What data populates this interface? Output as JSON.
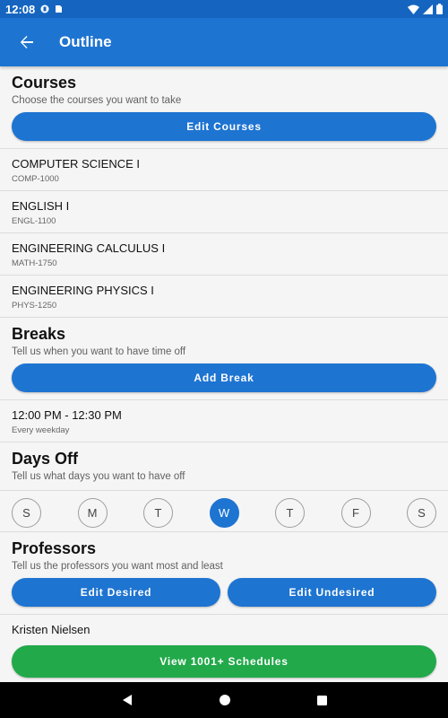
{
  "status_bar": {
    "time": "12:08"
  },
  "app_bar": {
    "title": "Outline",
    "back_icon": "arrow-back-icon"
  },
  "courses": {
    "title": "Courses",
    "subtitle": "Choose the courses you want to take",
    "button_label": "Edit Courses",
    "items": [
      {
        "name": "COMPUTER SCIENCE I",
        "code": "COMP-1000"
      },
      {
        "name": "ENGLISH I",
        "code": "ENGL-1100"
      },
      {
        "name": "ENGINEERING CALCULUS I",
        "code": "MATH-1750"
      },
      {
        "name": "ENGINEERING PHYSICS I",
        "code": "PHYS-1250"
      }
    ]
  },
  "breaks": {
    "title": "Breaks",
    "subtitle": "Tell us when you want to have time off",
    "button_label": "Add Break",
    "items": [
      {
        "time": "12:00 PM - 12:30 PM",
        "repeat": "Every weekday"
      }
    ]
  },
  "days_off": {
    "title": "Days Off",
    "subtitle": "Tell us what days you want to have off",
    "days": [
      "S",
      "M",
      "T",
      "W",
      "T",
      "F",
      "S"
    ],
    "selected_index": 3
  },
  "professors": {
    "title": "Professors",
    "subtitle": "Tell us the professors you want most and least",
    "desired_label": "Edit Desired",
    "undesired_label": "Edit Undesired",
    "items": [
      "Kristen Nielsen"
    ]
  },
  "view_button_label": "View 1001+ Schedules",
  "colors": {
    "primary": "#1e74d1",
    "status_bar": "#1565c0",
    "accent_green": "#22a94a"
  }
}
